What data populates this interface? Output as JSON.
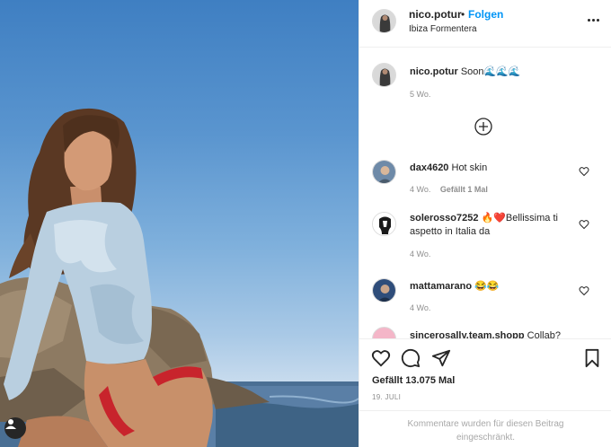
{
  "post": {
    "username": "nico.potur",
    "separator": "•",
    "follow_label": "Folgen",
    "location": "Ibiza Formentera",
    "photo_alt": "avatar-badge"
  },
  "caption": {
    "username": "nico.potur",
    "text": "Soon🌊🌊🌊",
    "time": "5 Wo."
  },
  "comments": [
    {
      "username": "dax4620",
      "text": "Hot skin",
      "time": "4 Wo.",
      "likes": "Gefällt 1 Mal"
    },
    {
      "username": "solerosso7252",
      "text": "🔥❤️Bellissima ti aspetto in Italia da",
      "time": "4 Wo.",
      "likes": ""
    },
    {
      "username": "mattamarano",
      "text": "😂😂",
      "time": "4 Wo.",
      "likes": ""
    },
    {
      "username": "sincerosally.team.shopp",
      "text": "Collab?",
      "time": "",
      "likes": ""
    }
  ],
  "footer": {
    "likes_count": "Gefällt 13.075 Mal",
    "date": "19. JULI",
    "comments_disabled": "Kommentare wurden für diesen Beitrag eingeschränkt."
  },
  "colors": {
    "accent": "#0095f6",
    "text": "#262626",
    "muted": "#8e8e8e",
    "border": "#efefef"
  },
  "icons": [
    "more-options-icon",
    "add-comments-icon",
    "heart-icon",
    "comment-icon",
    "share-icon",
    "bookmark-icon",
    "user-tag-icon"
  ]
}
